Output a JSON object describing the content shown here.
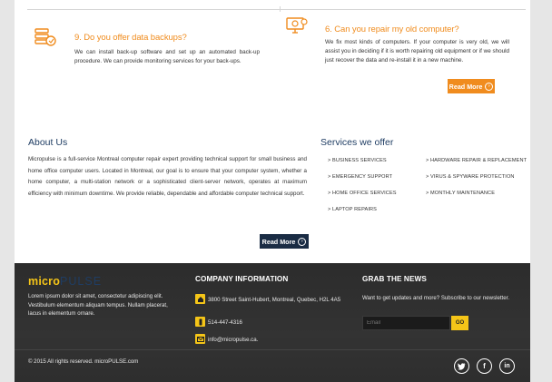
{
  "services": [
    {
      "icon": "server-backup-icon",
      "title": "9. Do you offer data backups?",
      "text": "We can install back-up software and set up an automated back-up procedure. We can provide monitoring services for your back-ups."
    },
    {
      "icon": "computer-repair-icon",
      "title": "6. Can you repair my old computer?",
      "text": "We fix most kinds of computers. If your computer is very old, we will assist you in deciding if it is worth repairing old equipment or if we should just recover the data and re-install it in a new machine."
    }
  ],
  "read_more_orange": "Read More",
  "about": {
    "heading": "About Us",
    "text": "Micropulse is a full-service Montreal computer repair expert providing technical support for small business and home office computer users. Located in Montreal, our goal is to ensure that your computer system, whether a home computer, a multi-station network or a sophisticated client-server network, operates at maximum efficiency with minimum downtime. We provide reliable, dependable and affordable computer technical support.",
    "read_more": "Read More"
  },
  "services_offer": {
    "heading": "Services we offer",
    "col1": [
      "> BUSINESS SERVICES",
      "> EMERGENCY SUPPORT",
      "> HOME OFFICE SERVICES",
      "> LAPTOP REPAIRS"
    ],
    "col2": [
      "> HARDWARE REPAIR & REPLACEMENT",
      "> VIRUS & SPYWARE PROTECTION",
      "> MONTHLY MAINTENANCE"
    ]
  },
  "footer": {
    "logo_a": "micro",
    "logo_b": "PULSE",
    "tagline": "Lorem ipsum dolor sit amet, consectetur adipiscing elit. Vestibulum elementum aliquam tempus. Nullam placerat, lacus in elementum ornare.",
    "company_heading": "COMPANY INFORMATION",
    "address": "3800 Street Saint-Hubert, Montreal, Quebec, H2L 4A5",
    "phone": "514-447-4316",
    "email": "info@micropulse.ca.",
    "news_heading": "GRAB THE NEWS",
    "news_text": "Want to get updates and more? Subscribe to our newsletter.",
    "email_placeholder": "Email",
    "go_label": "GO",
    "copyright": "© 2015 All rights reserved. microPULSE.com"
  },
  "social": [
    "twitter-icon",
    "facebook-icon",
    "linkedin-icon"
  ]
}
